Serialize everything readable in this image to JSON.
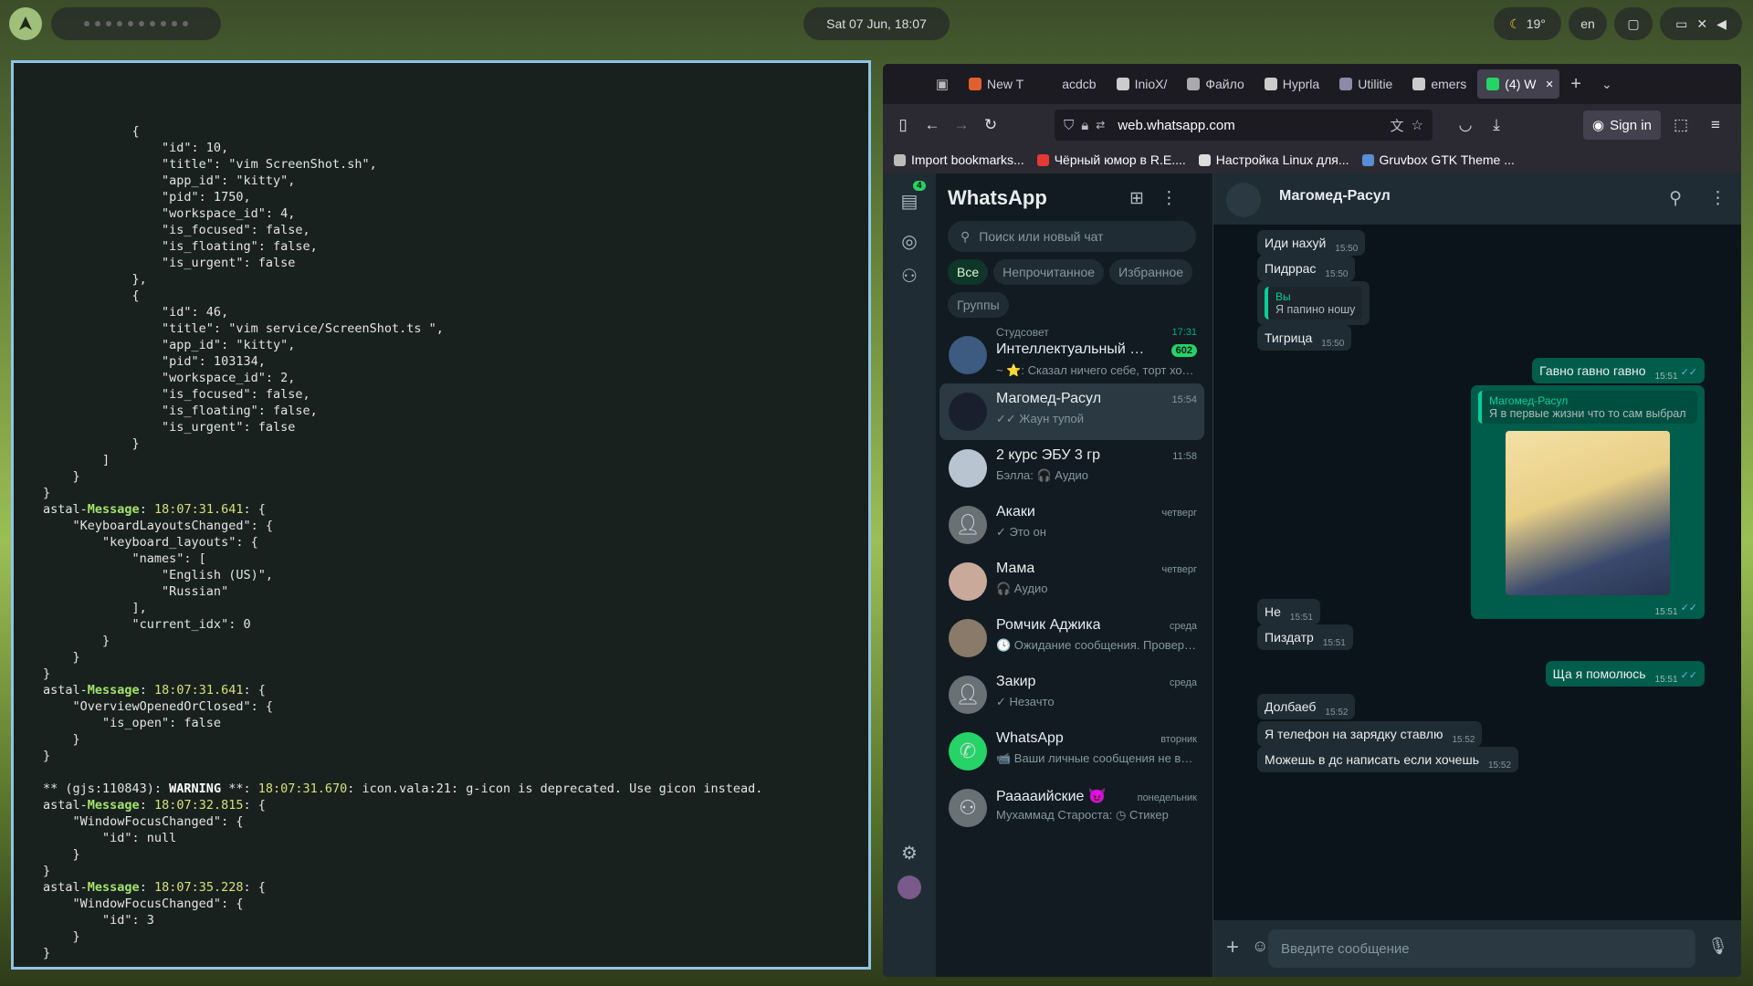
{
  "topbar": {
    "clock": "Sat 07 Jun, 18:07",
    "weather": "19°",
    "lang": "en"
  },
  "terminal": {
    "lines": [
      "            {",
      "                \"id\": 10,",
      "                \"title\": \"vim ScreenShot.sh\",",
      "                \"app_id\": \"kitty\",",
      "                \"pid\": 1750,",
      "                \"workspace_id\": 4,",
      "                \"is_focused\": false,",
      "                \"is_floating\": false,",
      "                \"is_urgent\": false",
      "            },",
      "            {",
      "                \"id\": 46,",
      "                \"title\": \"vim service/ScreenShot.ts \",",
      "                \"app_id\": \"kitty\",",
      "                \"pid\": 103134,",
      "                \"workspace_id\": 2,",
      "                \"is_focused\": false,",
      "                \"is_floating\": false,",
      "                \"is_urgent\": false",
      "            }",
      "        ]",
      "    }",
      "}",
      "astal-Message: 18:07:31.641: {",
      "    \"KeyboardLayoutsChanged\": {",
      "        \"keyboard_layouts\": {",
      "            \"names\": [",
      "                \"English (US)\",",
      "                \"Russian\"",
      "            ],",
      "            \"current_idx\": 0",
      "        }",
      "    }",
      "}",
      "astal-Message: 18:07:31.641: {",
      "    \"OverviewOpenedOrClosed\": {",
      "        \"is_open\": false",
      "    }",
      "}",
      "",
      "** (gjs:110843): WARNING **: 18:07:31.670: icon.vala:21: g-icon is deprecated. Use gicon instead.",
      "astal-Message: 18:07:32.815: {",
      "    \"WindowFocusChanged\": {",
      "        \"id\": null",
      "    }",
      "}",
      "astal-Message: 18:07:35.228: {",
      "    \"WindowFocusChanged\": {",
      "        \"id\": 3",
      "    }",
      "}"
    ]
  },
  "browser": {
    "tabs": [
      {
        "label": "New T",
        "color": "#e0612f"
      },
      {
        "label": "acdcb",
        "color": ""
      },
      {
        "label": "InioX/",
        "color": "#cccccc"
      },
      {
        "label": "Файло",
        "color": "#aaaaaa"
      },
      {
        "label": "Hyprla",
        "color": "#cccccc"
      },
      {
        "label": "Utilitie",
        "color": "#8a8aa8"
      },
      {
        "label": "emers",
        "color": "#cccccc"
      },
      {
        "label": "(4) W",
        "color": "#25d366"
      }
    ],
    "url": "web.whatsapp.com",
    "sign_in": "Sign in",
    "bookmarks": [
      {
        "label": "Import bookmarks...",
        "color": "#bbbbbb"
      },
      {
        "label": "Чёрный юмор в R.E....",
        "color": "#e53935"
      },
      {
        "label": "Настройка Linux для...",
        "color": "#dddddd"
      },
      {
        "label": "Gruvbox GTK Theme ...",
        "color": "#5b8dd6"
      }
    ]
  },
  "whatsapp": {
    "title": "WhatsApp",
    "rail_badge": "4",
    "search_placeholder": "Поиск или новый чат",
    "filters": [
      "Все",
      "Непрочитанное",
      "Избранное",
      "Группы"
    ],
    "chats": [
      {
        "group": "Студсовет",
        "name": "Интеллектуальный сек...",
        "time": "17:31",
        "preview": "~ ⭐: Сказал ничего себе, торт ходит",
        "badge": "602"
      },
      {
        "name": "Магомед-Расул",
        "time": "15:54",
        "preview": "✓✓ Жаун тупой"
      },
      {
        "name": "2 курс ЭБУ 3 гр",
        "time": "11:58",
        "preview": "Бэлла: 🎧 Аудио"
      },
      {
        "name": "Акаки",
        "time": "четверг",
        "preview": "✓ Это он"
      },
      {
        "name": "Мама",
        "time": "четверг",
        "preview": "🎧 Аудио"
      },
      {
        "name": "Ромчик Аджика",
        "time": "среда",
        "preview": "🕓 Ожидание сообщения. Проверьте..."
      },
      {
        "name": "Закир",
        "time": "среда",
        "preview": "✓ Незачто"
      },
      {
        "name": "WhatsApp",
        "time": "вторник",
        "preview": "📹 Ваши личные сообщения не вид..."
      },
      {
        "name": "Рааааийские 😈",
        "time": "понедельник",
        "preview": "Мухаммад Староста: ◷ Стикер"
      }
    ],
    "conversation": {
      "name": "Магомед-Расул",
      "composer_placeholder": "Введите сообщение",
      "messages": [
        {
          "dir": "in",
          "text": "Иди нахуй",
          "time": "15:50"
        },
        {
          "dir": "in",
          "text": "Пидррас",
          "time": "15:50"
        },
        {
          "dir": "in",
          "quote_name": "Вы",
          "quote_text": "Я папино ношу",
          "text": "",
          "time": ""
        },
        {
          "dir": "in",
          "text": "Тигрица",
          "time": "15:50"
        },
        {
          "dir": "out",
          "text": "Гавно гавно гавно",
          "time": "15:51"
        },
        {
          "dir": "out",
          "quote_name": "Магомед-Расул",
          "quote_text": "Я в первые жизни что то сам выбрал",
          "text": "",
          "time": "15:51"
        },
        {
          "dir": "in",
          "text": "Не",
          "time": "15:51"
        },
        {
          "dir": "in",
          "text": "Пиздатр",
          "time": "15:51"
        },
        {
          "dir": "out",
          "text": "Ща я помолюсь",
          "time": "15:51"
        },
        {
          "dir": "in",
          "text": "Долбаеб",
          "time": "15:52"
        },
        {
          "dir": "in",
          "text": "Я телефон на зарядку ставлю",
          "time": "15:52"
        },
        {
          "dir": "in",
          "text": "Можешь в дс написать если хочешь",
          "time": "15:52"
        }
      ]
    }
  }
}
